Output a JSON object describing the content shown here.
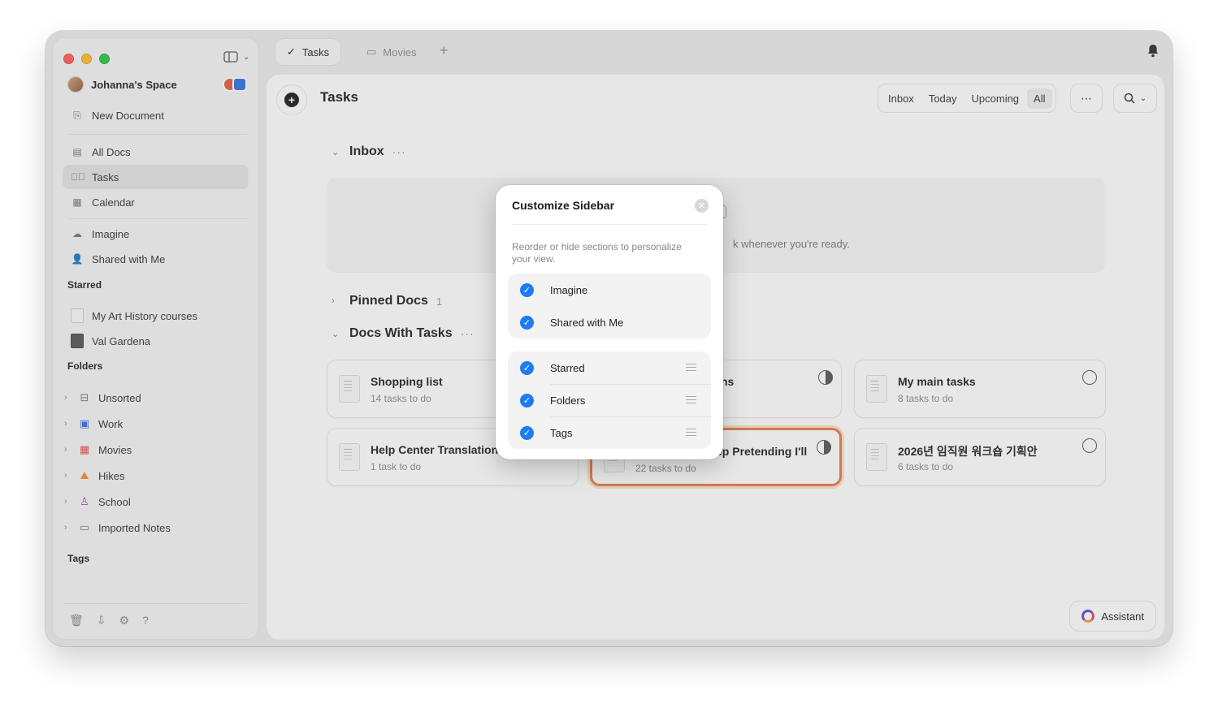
{
  "sidebar": {
    "space_name": "Johanna's Space",
    "new_document": "New Document",
    "nav": [
      {
        "label": "All Docs",
        "icon": "doc-icon"
      },
      {
        "label": "Tasks",
        "icon": "checkmark-circle-icon"
      },
      {
        "label": "Calendar",
        "icon": "calendar-icon"
      }
    ],
    "extra": [
      {
        "label": "Imagine",
        "icon": "cloud-icon"
      },
      {
        "label": "Shared with Me",
        "icon": "shared-person-icon"
      }
    ],
    "starred_heading": "Starred",
    "starred": [
      {
        "label": "My Art History courses"
      },
      {
        "label": "Val Gardena"
      }
    ],
    "folders_heading": "Folders",
    "folders": [
      {
        "label": "Unsorted",
        "icon": "tray-icon",
        "color": "#7a7a7a"
      },
      {
        "label": "Work",
        "icon": "building-icon",
        "color": "#2f6fe4"
      },
      {
        "label": "Movies",
        "icon": "calendar-red-icon",
        "color": "#e54848"
      },
      {
        "label": "Hikes",
        "icon": "mountain-icon",
        "color": "#f08a34"
      },
      {
        "label": "School",
        "icon": "person-purple-icon",
        "color": "#a340d8"
      },
      {
        "label": "Imported Notes",
        "icon": "folder-icon",
        "color": "#7a7a7a"
      }
    ],
    "tags_heading": "Tags"
  },
  "tabs": [
    {
      "label": "Tasks",
      "icon": "checkmark-circle-icon"
    },
    {
      "label": "Movies",
      "icon": "folder-icon"
    }
  ],
  "main": {
    "title": "Tasks",
    "filters": [
      "Inbox",
      "Today",
      "Upcoming",
      "All"
    ],
    "selected_filter": "All",
    "inbox_label": "Inbox",
    "inbox_empty_text": "k whenever you're ready.",
    "pinned_label": "Pinned Docs",
    "pinned_count": "1",
    "docs_with_tasks_label": "Docs With Tasks",
    "cards": [
      {
        "title": "Shopping list",
        "sub": "14 tasks to do"
      },
      {
        "title": "ns",
        "sub": ""
      },
      {
        "title": "My main tasks",
        "sub": "8 tasks to do"
      },
      {
        "title": "Help Center Translation",
        "sub": "1 task to do"
      },
      {
        "title": "ep Pretending I'll",
        "sub": "22 tasks to do"
      },
      {
        "title": "2026년 임직원 워크숍 기획안",
        "sub": "6 tasks to do"
      }
    ],
    "assistant_label": "Assistant"
  },
  "popover": {
    "title": "Customize Sidebar",
    "description": "Reorder or hide sections to personalize your view.",
    "group1": [
      {
        "label": "Imagine",
        "checked": true
      },
      {
        "label": "Shared with Me",
        "checked": true
      }
    ],
    "group2": [
      {
        "label": "Starred",
        "checked": true
      },
      {
        "label": "Folders",
        "checked": true
      },
      {
        "label": "Tags",
        "checked": true
      }
    ]
  },
  "colors": {
    "accent": "#1e7cf2",
    "highlight_border": "#e27b4d"
  }
}
